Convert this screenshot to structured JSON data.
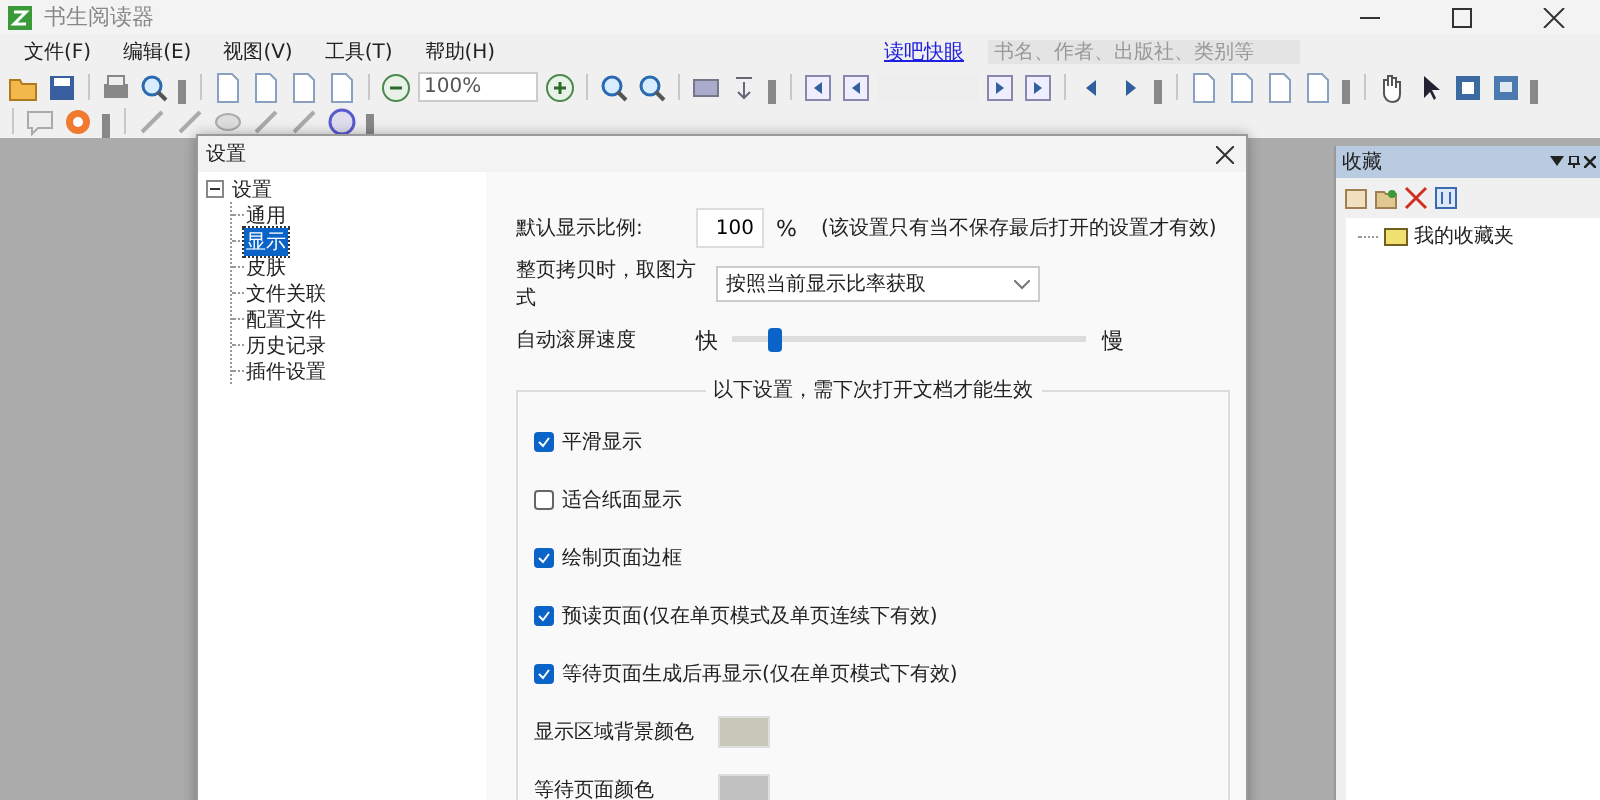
{
  "window": {
    "title": "书生阅读器"
  },
  "menu": [
    {
      "label": "文件(F)"
    },
    {
      "label": "编辑(E)"
    },
    {
      "label": "视图(V)"
    },
    {
      "label": "工具(T)"
    },
    {
      "label": "帮助(H)"
    }
  ],
  "header_link": "读吧快眼",
  "search": {
    "placeholder": "书名、作者、出版社、类别等"
  },
  "toolbar": {
    "zoom": "100%"
  },
  "dialog": {
    "title": "设置",
    "tree": {
      "label": "设置",
      "expanded": true,
      "children": [
        {
          "label": "通用",
          "selected": false
        },
        {
          "label": "显示",
          "selected": true
        },
        {
          "label": "皮肤",
          "selected": false
        },
        {
          "label": "文件关联",
          "selected": false
        },
        {
          "label": "配置文件",
          "selected": false
        },
        {
          "label": "历史记录",
          "selected": false
        },
        {
          "label": "插件设置",
          "selected": false
        }
      ]
    },
    "default_zoom": {
      "label": "默认显示比例:",
      "value": "100",
      "unit": "%",
      "note": "(该设置只有当不保存最后打开的设置才有效)"
    },
    "copy_mode": {
      "label": "整页拷贝时，取图方式",
      "value": "按照当前显示比率获取"
    },
    "scroll_speed": {
      "label": "自动滚屏速度",
      "min_label": "快",
      "max_label": "慢",
      "level": 0.12
    },
    "group": {
      "title": "以下设置，需下次打开文档才能生效",
      "options": [
        {
          "kind": "checkbox",
          "label": "平滑显示",
          "checked": true
        },
        {
          "kind": "checkbox",
          "label": "适合纸面显示",
          "checked": false
        },
        {
          "kind": "checkbox",
          "label": "绘制页面边框",
          "checked": true
        },
        {
          "kind": "checkbox",
          "label": "预读页面(仅在单页模式及单页连续下有效)",
          "checked": true
        },
        {
          "kind": "checkbox",
          "label": "等待页面生成后再显示(仅在单页模式下有效)",
          "checked": true
        },
        {
          "kind": "color",
          "label": "显示区域背景颜色",
          "color": "#c8c8b8"
        },
        {
          "kind": "color",
          "label": "等待页面颜色",
          "color": "#c0c0c0"
        }
      ]
    }
  },
  "favorites": {
    "title": "收藏",
    "items": [
      {
        "label": "我的收藏夹"
      }
    ]
  }
}
